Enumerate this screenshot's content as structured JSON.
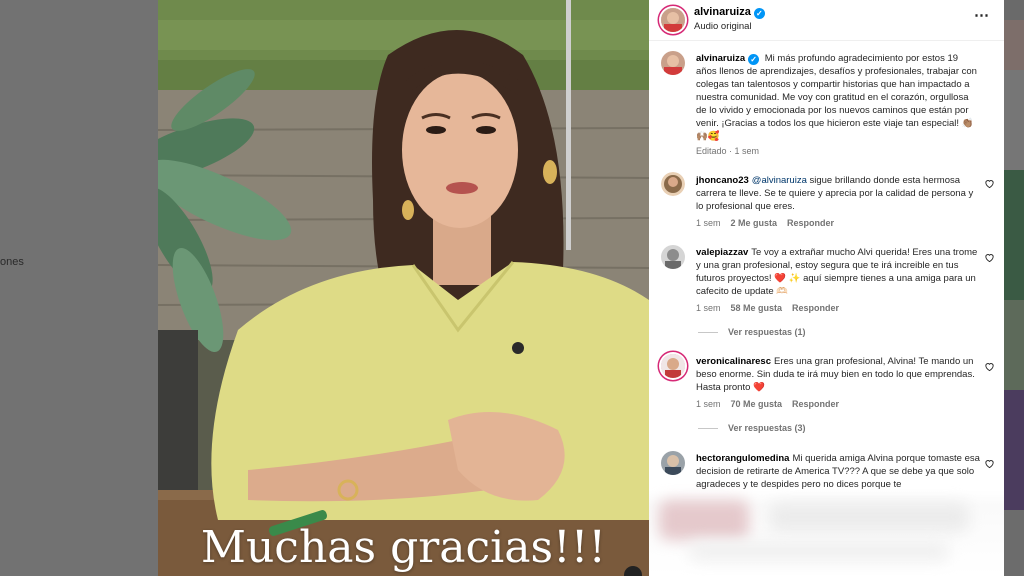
{
  "backdrop": {
    "partial_text": "ones"
  },
  "post": {
    "username": "alvinaruiza",
    "audio": "Audio original",
    "caption_text": "Mi más profundo agradecimiento por estos 19 años llenos de aprendizajes, desafíos y profesionales, trabajar con colegas tan talentosos y compartir historias que han impactado a nuestra comunidad. Me voy con gratitud en el corazón, orgullosa de lo vivido y emocionada por los nuevos caminos que están por venir. ¡Gracias a todos los que hicieron este viaje tan especial! 👏🏽🙌🏽🥰",
    "caption_meta": "Editado · 1 sem",
    "video_overlay_text": "Muchas gracias!!!",
    "more_icon": "⋯"
  },
  "comments": [
    {
      "username": "jhoncano23",
      "mention": "@alvinaruiza",
      "text": " sigue brillando donde esta hermosa carrera te lleve. Se te quiere y aprecia por la calidad de persona y lo profesional que eres.",
      "time": "1 sem",
      "likes": "2 Me gusta",
      "reply": "Responder"
    },
    {
      "username": "valepiazzav",
      "text": "Te voy a extrañar mucho Alvi querida! Eres una trome y una gran profesional, estoy segura que te irá increible en tus futuros proyectos! ❤️ ✨ aquí siempre tienes a una amiga para un cafecito de update 🫶🏻",
      "time": "1 sem",
      "likes": "58 Me gusta",
      "reply": "Responder",
      "view_replies": "Ver respuestas (1)"
    },
    {
      "username": "veronicalinaresc",
      "text": "Eres una gran profesional, Alvina! Te mando un beso enorme. Sin duda te irá muy bien en todo lo que emprendas. Hasta pronto ❤️",
      "time": "1 sem",
      "likes": "70 Me gusta",
      "reply": "Responder",
      "view_replies": "Ver respuestas (3)"
    },
    {
      "username": "hectorangulomedina",
      "text": "Mi querida amiga Alvina porque tomaste esa decision de retirarte de America TV??? A que se debe ya que solo agradeces y te despides pero no dices porque te"
    }
  ],
  "colors": {
    "verified": "#0095f6",
    "link": "#00376b",
    "muted": "#737373",
    "story_ring": "#d62976"
  }
}
